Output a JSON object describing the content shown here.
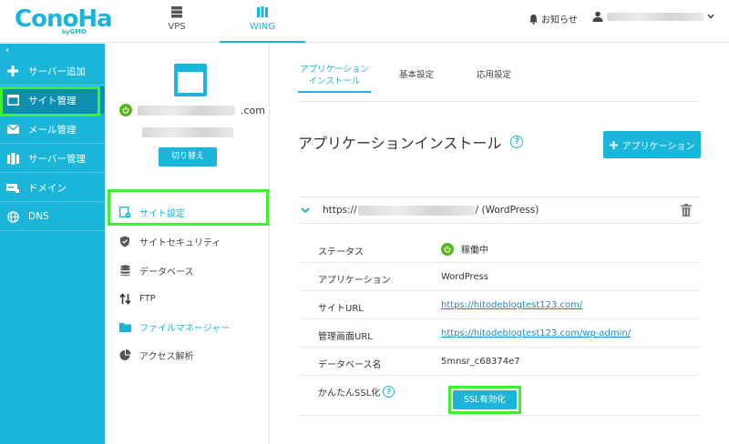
{
  "header": {
    "logo_text": "ConoHa",
    "logo_sub_prefix": "by",
    "logo_sub_brand": "GMO",
    "tabs": [
      {
        "label": "VPS",
        "icon": "server-icon"
      },
      {
        "label": "WING",
        "icon": "wing-icon"
      }
    ],
    "notice_label": "お知らせ"
  },
  "sidebar": {
    "collapse_glyph": "‹",
    "items": [
      {
        "label": "サーバー追加",
        "icon": "plus-icon"
      },
      {
        "label": "サイト管理",
        "icon": "window-icon"
      },
      {
        "label": "メール管理",
        "icon": "mail-icon"
      },
      {
        "label": "サーバー管理",
        "icon": "server-manage-icon"
      },
      {
        "label": "ドメイン",
        "icon": "domain-icon"
      },
      {
        "label": "DNS",
        "icon": "globe-icon"
      }
    ]
  },
  "site_panel": {
    "domain_suffix": ".com",
    "switch_label": "切り替え",
    "menu": [
      {
        "label": "サイト設定",
        "icon": "site-settings-icon"
      },
      {
        "label": "サイトセキュリティ",
        "icon": "shield-icon"
      },
      {
        "label": "データベース",
        "icon": "database-icon"
      },
      {
        "label": "FTP",
        "icon": "ftp-arrows-icon"
      },
      {
        "label": "ファイルマネージャー",
        "icon": "folder-icon"
      },
      {
        "label": "アクセス解析",
        "icon": "pie-chart-icon"
      }
    ]
  },
  "content": {
    "tabs": [
      {
        "line1": "アプリケーション",
        "line2": "インストール"
      },
      {
        "line1": "基本設定",
        "line2": ""
      },
      {
        "line1": "応用設定",
        "line2": ""
      }
    ],
    "page_title": "アプリケーションインストール",
    "help_glyph": "?",
    "add_button_label": "アプリケーション",
    "app_entry": {
      "url_prefix": "https://",
      "url_suffix": "/ (WordPress)"
    },
    "details": [
      {
        "key": "ステータス",
        "value": "稼働中"
      },
      {
        "key": "アプリケーション",
        "value": "WordPress"
      },
      {
        "key": "サイトURL",
        "value": "https://hitodeblogtest123.com/"
      },
      {
        "key": "管理画面URL",
        "value": "https://hitodeblogtest123.com/wp-admin/"
      },
      {
        "key": "データベース名",
        "value": "5mnsr_c68374e7"
      },
      {
        "key": "かんたんSSL化",
        "value": ""
      }
    ],
    "ssl_button_label": "SSL有効化"
  },
  "colors": {
    "accent": "#1ab5d9",
    "highlight": "#3ef030",
    "status_green": "#55b71e",
    "link": "#1a8bc4"
  }
}
